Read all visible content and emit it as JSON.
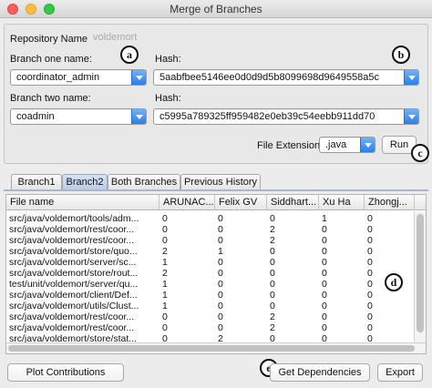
{
  "window": {
    "title": "Merge of Branches"
  },
  "repo": {
    "label": "Repository Name",
    "value": "voldemort"
  },
  "branch_one": {
    "label": "Branch one name:",
    "value": "coordinator_admin",
    "hash_label": "Hash:",
    "hash": "5aabfbee5146ee0d0d9d5b8099698d9649558a5c"
  },
  "branch_two": {
    "label": "Branch two name:",
    "value": "coadmin",
    "hash_label": "Hash:",
    "hash": "c5995a789325ff959482e0eb39c54eebb911dd70"
  },
  "file_ext": {
    "label": "File Extension",
    "value": ".java"
  },
  "run_label": "Run",
  "badges": {
    "a": "a",
    "b": "b",
    "c": "c",
    "d": "d",
    "e": "e"
  },
  "tabs": [
    "Branch1",
    "Branch2",
    "Both Branches",
    "Previous History"
  ],
  "table": {
    "columns": [
      "File name",
      "ARUNAC...",
      "Felix GV",
      "Siddhart...",
      "Xu Ha",
      "Zhongj..."
    ],
    "rows": [
      [
        "src/java/voldemort/tools/adm...",
        "0",
        "0",
        "0",
        "1",
        "0"
      ],
      [
        "src/java/voldemort/rest/coor...",
        "0",
        "0",
        "2",
        "0",
        "0"
      ],
      [
        "src/java/voldemort/rest/coor...",
        "0",
        "0",
        "2",
        "0",
        "0"
      ],
      [
        "src/java/voldemort/store/quo...",
        "2",
        "1",
        "0",
        "0",
        "0"
      ],
      [
        "src/java/voldemort/server/sc...",
        "1",
        "0",
        "0",
        "0",
        "0"
      ],
      [
        "src/java/voldemort/store/rout...",
        "2",
        "0",
        "0",
        "0",
        "0"
      ],
      [
        "test/unit/voldemort/server/qu...",
        "1",
        "0",
        "0",
        "0",
        "0"
      ],
      [
        "src/java/voldemort/client/Def...",
        "1",
        "0",
        "0",
        "0",
        "0"
      ],
      [
        "src/java/voldemort/utils/Clust...",
        "1",
        "0",
        "0",
        "0",
        "0"
      ],
      [
        "src/java/voldemort/rest/coor...",
        "0",
        "0",
        "2",
        "0",
        "0"
      ],
      [
        "src/java/voldemort/rest/coor...",
        "0",
        "0",
        "2",
        "0",
        "0"
      ],
      [
        "src/java/voldemort/store/stat...",
        "0",
        "2",
        "0",
        "0",
        "0"
      ]
    ]
  },
  "buttons": {
    "plot": "Plot Contributions",
    "deps": "Get Dependencies",
    "export": "Export"
  }
}
